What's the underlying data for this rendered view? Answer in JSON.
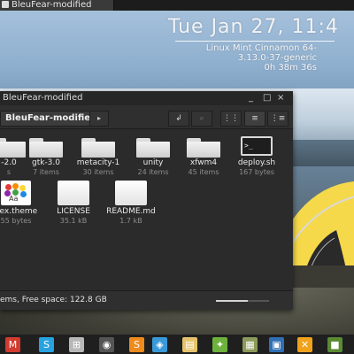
{
  "topbar": {
    "window_tab": "BleuFear-modified"
  },
  "conky": {
    "datetime": "Tue Jan 27, 11:4",
    "os": "Linux Mint Cinnamon 64-",
    "kernel": "3.13.0-37-generic",
    "uptime": "0h 38m 36s"
  },
  "window": {
    "title": "BleuFear-modified",
    "controls": {
      "minimize": "_",
      "maximize": "□",
      "close": "×"
    }
  },
  "toolbar": {
    "breadcrumb": "BleuFear-modified",
    "breadcrumb_more": "▸",
    "back_icon": "↲",
    "search_icon": "⌕",
    "view_icons": "⋮⋮",
    "view_list": "≡",
    "view_compact": "⋮≡"
  },
  "items": [
    {
      "name": "-2.0",
      "meta": "s",
      "icon": "folder-icon"
    },
    {
      "name": "gtk-3.0",
      "meta": "7 items",
      "icon": "folder-icon"
    },
    {
      "name": "metacity-1",
      "meta": "30 items",
      "icon": "folder-icon"
    },
    {
      "name": "unity",
      "meta": "24 items",
      "icon": "folder-icon"
    },
    {
      "name": "xfwm4",
      "meta": "45 items",
      "icon": "folder-icon"
    },
    {
      "name": "deploy.sh",
      "meta": "167 bytes",
      "icon": "terminal-script-icon"
    },
    {
      "name": "dex.theme",
      "meta": "55 bytes",
      "icon": "theme-file-icon"
    },
    {
      "name": "LICENSE",
      "meta": "35.1 kB",
      "icon": "document-icon"
    },
    {
      "name": "README.md",
      "meta": "1.7 kB",
      "icon": "document-icon"
    }
  ],
  "terminal_prompt": ">_",
  "theme_label": "Aa",
  "statusbar": {
    "text": "ems, Free space: 122.8 GB",
    "zoom_fraction": 0.6
  },
  "panel": {
    "launchers": [
      {
        "icon": "gmail-icon",
        "glyph": "M",
        "color": "#d23b2f"
      },
      {
        "icon": "skype-icon",
        "glyph": "S",
        "color": "#27a3e2"
      },
      {
        "icon": "app-grid-icon",
        "glyph": "⊞",
        "color": "#b8b8b8"
      },
      {
        "icon": "camera-icon",
        "glyph": "◉",
        "color": "#555555"
      },
      {
        "icon": "sublime-text-icon",
        "glyph": "S",
        "color": "#ef8a1c"
      },
      {
        "icon": "network-icon",
        "glyph": "◈",
        "color": "#3a9ad9"
      },
      {
        "icon": "archive-manager-icon",
        "glyph": "▤",
        "color": "#e6c36b"
      },
      {
        "icon": "paint-icon",
        "glyph": "✦",
        "color": "#6db23c"
      },
      {
        "icon": "image-viewer-icon",
        "glyph": "▦",
        "color": "#8b9a5a"
      },
      {
        "icon": "virtualbox-icon",
        "glyph": "▣",
        "color": "#2f6fb5"
      },
      {
        "icon": "crossover-icon",
        "glyph": "✕",
        "color": "#f0a21b"
      },
      {
        "icon": "minecraft-icon",
        "glyph": "■",
        "color": "#5a8a33"
      }
    ]
  }
}
